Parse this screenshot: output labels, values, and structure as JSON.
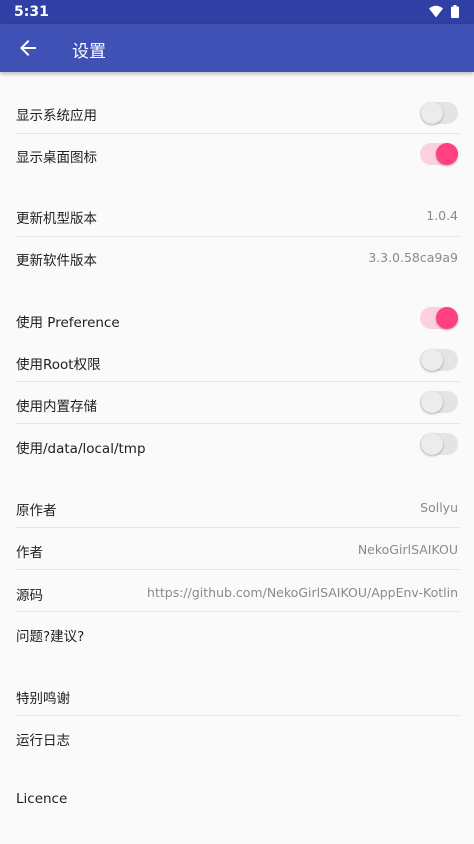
{
  "status_bar": {
    "time": "5:31"
  },
  "app_bar": {
    "title": "设置"
  },
  "sections": {
    "display": {
      "show_system_apps": {
        "label": "显示系统应用",
        "enabled": false
      },
      "show_desktop_icon": {
        "label": "显示桌面图标",
        "enabled": true
      }
    },
    "versions": {
      "model_version": {
        "label": "更新机型版本",
        "value": "1.0.4"
      },
      "software_version": {
        "label": "更新软件版本",
        "value": "3.3.0.58ca9a9"
      }
    },
    "storage": {
      "use_preference": {
        "label": "使用 Preference",
        "enabled": true
      },
      "use_root": {
        "label": "使用Root权限",
        "enabled": false
      },
      "use_internal_storage": {
        "label": "使用内置存储",
        "enabled": false
      },
      "use_tmp": {
        "label": "使用/data/local/tmp",
        "enabled": false
      }
    },
    "about": {
      "original_author": {
        "label": "原作者",
        "value": "Sollyu"
      },
      "author": {
        "label": "作者",
        "value": "NekoGirlSAIKOU"
      },
      "source_code": {
        "label": "源码",
        "value": "https://github.com/NekoGirlSAIKOU/AppEnv-Kotlin"
      },
      "feedback": {
        "label": "问题?建议?"
      }
    },
    "misc": {
      "thanks": {
        "label": "特别鸣谢"
      },
      "logs": {
        "label": "运行日志"
      }
    },
    "licence": {
      "label": "Licence"
    }
  },
  "colors": {
    "status_bar": "#2f3fa3",
    "app_bar": "#3f51b5",
    "accent": "#ff4081",
    "background": "#fafafa"
  }
}
